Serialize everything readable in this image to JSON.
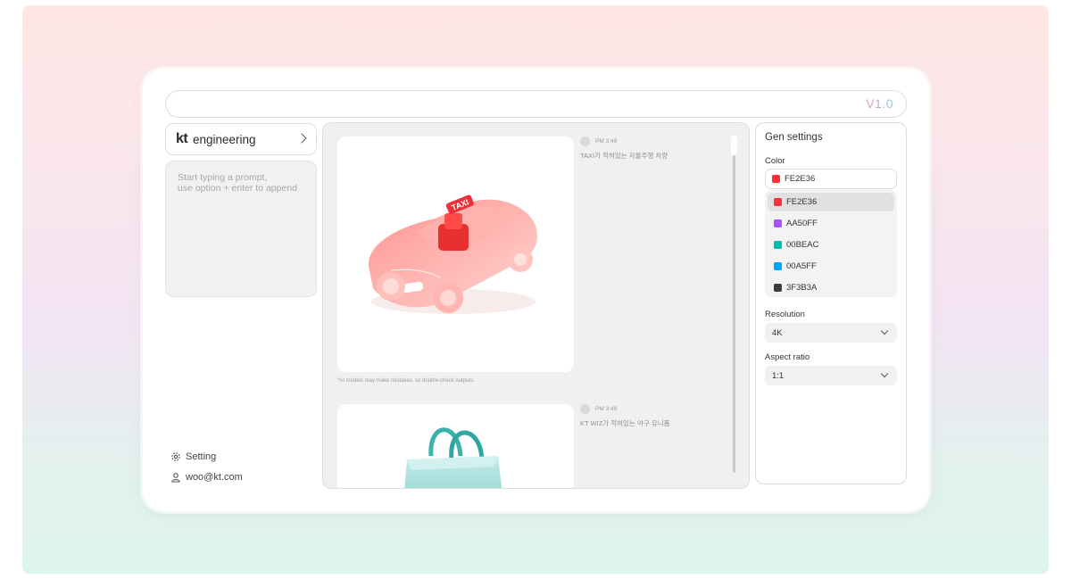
{
  "header": {
    "version": "V1.0"
  },
  "brand": {
    "logo_text": "kt",
    "name": "engineering"
  },
  "prompt": {
    "placeholder": "Start typing a prompt,\nuse option + enter to append"
  },
  "sidebar": {
    "setting_label": "Setting",
    "account_label": "woo@kt.com"
  },
  "feed": {
    "messages": [
      {
        "time": "PM 3:49",
        "text": "TAXI가 적혀있는 자율주행 차량"
      },
      {
        "time": "PM 3:49",
        "text": "KT WIZ가 적혀있는 야구 유니폼"
      }
    ],
    "disclaimer": "*AI models may make mistakes, so double-check outputs.",
    "taxi_sign": "TAXI"
  },
  "gen_settings": {
    "title": "Gen settings",
    "color_label": "Color",
    "selected_color": {
      "label": "FE2E36",
      "hex": "#FE2E36"
    },
    "color_options": [
      {
        "label": "FE2E36",
        "hex": "#FE2E36"
      },
      {
        "label": "AA50FF",
        "hex": "#AA50FF"
      },
      {
        "label": "00BEAC",
        "hex": "#00BEAC"
      },
      {
        "label": "00A5FF",
        "hex": "#00A5FF"
      },
      {
        "label": "3F3B3A",
        "hex": "#3F3B3A"
      }
    ],
    "resolution_label": "Resolution",
    "resolution_value": "4K",
    "aspect_label": "Aspect ratio",
    "aspect_value": "1:1"
  }
}
